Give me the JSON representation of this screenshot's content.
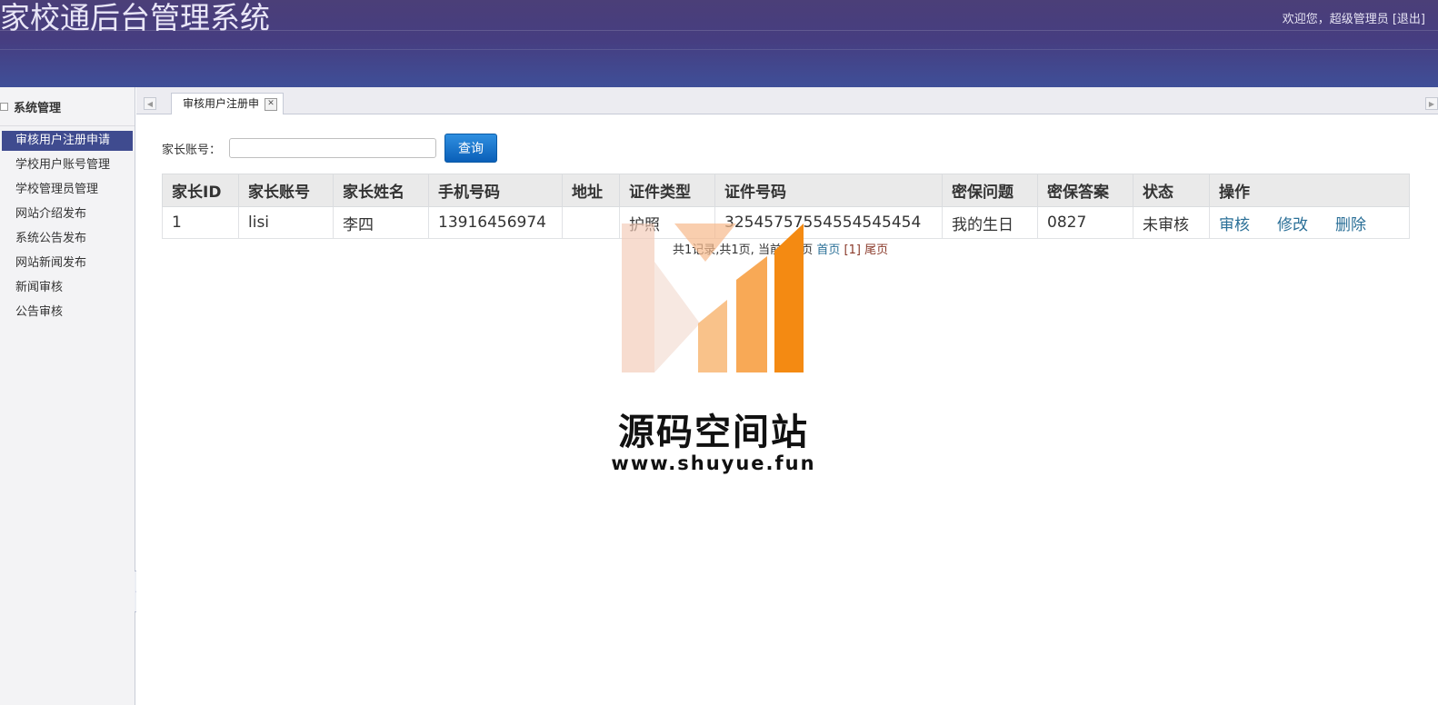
{
  "header": {
    "app_title": "家校通后台管理系统",
    "welcome_prefix": "欢迎您，超级管理员",
    "logout_label": "[退出]"
  },
  "sidebar": {
    "section_title": "系统管理",
    "items": [
      {
        "label": "审核用户注册申请",
        "active": true
      },
      {
        "label": "学校用户账号管理"
      },
      {
        "label": "学校管理员管理"
      },
      {
        "label": "网站介绍发布"
      },
      {
        "label": "系统公告发布"
      },
      {
        "label": "网站新闻发布"
      },
      {
        "label": "新闻审核"
      },
      {
        "label": "公告审核"
      }
    ]
  },
  "tabs": [
    {
      "label": "审核用户注册申",
      "close_glyph": "✕"
    }
  ],
  "search": {
    "label": "家长账号：",
    "value": "",
    "button_label": "查询"
  },
  "table": {
    "headers": [
      "家长ID",
      "家长账号",
      "家长姓名",
      "手机号码",
      "地址",
      "证件类型",
      "证件号码",
      "密保问题",
      "密保答案",
      "状态",
      "操作"
    ],
    "rows": [
      {
        "id": "1",
        "account": "lisi",
        "name": "李四",
        "phone": "13916456974",
        "address": "",
        "id_type": "护照",
        "id_number": "32545757554554545454",
        "question": "我的生日",
        "answer": "0827",
        "status": "未审核",
        "actions": [
          "审核",
          "修改",
          "删除"
        ]
      }
    ]
  },
  "pager": {
    "summary": "共1记录,共1页, 当前第1页",
    "first_label": "首页",
    "current_label": "[1]",
    "last_label": "尾页"
  },
  "watermark": {
    "site_name": "源码空间站",
    "url": "www.shuyue.fun"
  },
  "colors": {
    "header_bg": "#463d80",
    "active_menu_bg": "#3f4b8f",
    "link": "#2a6f97",
    "button": "#0a5fb8"
  }
}
